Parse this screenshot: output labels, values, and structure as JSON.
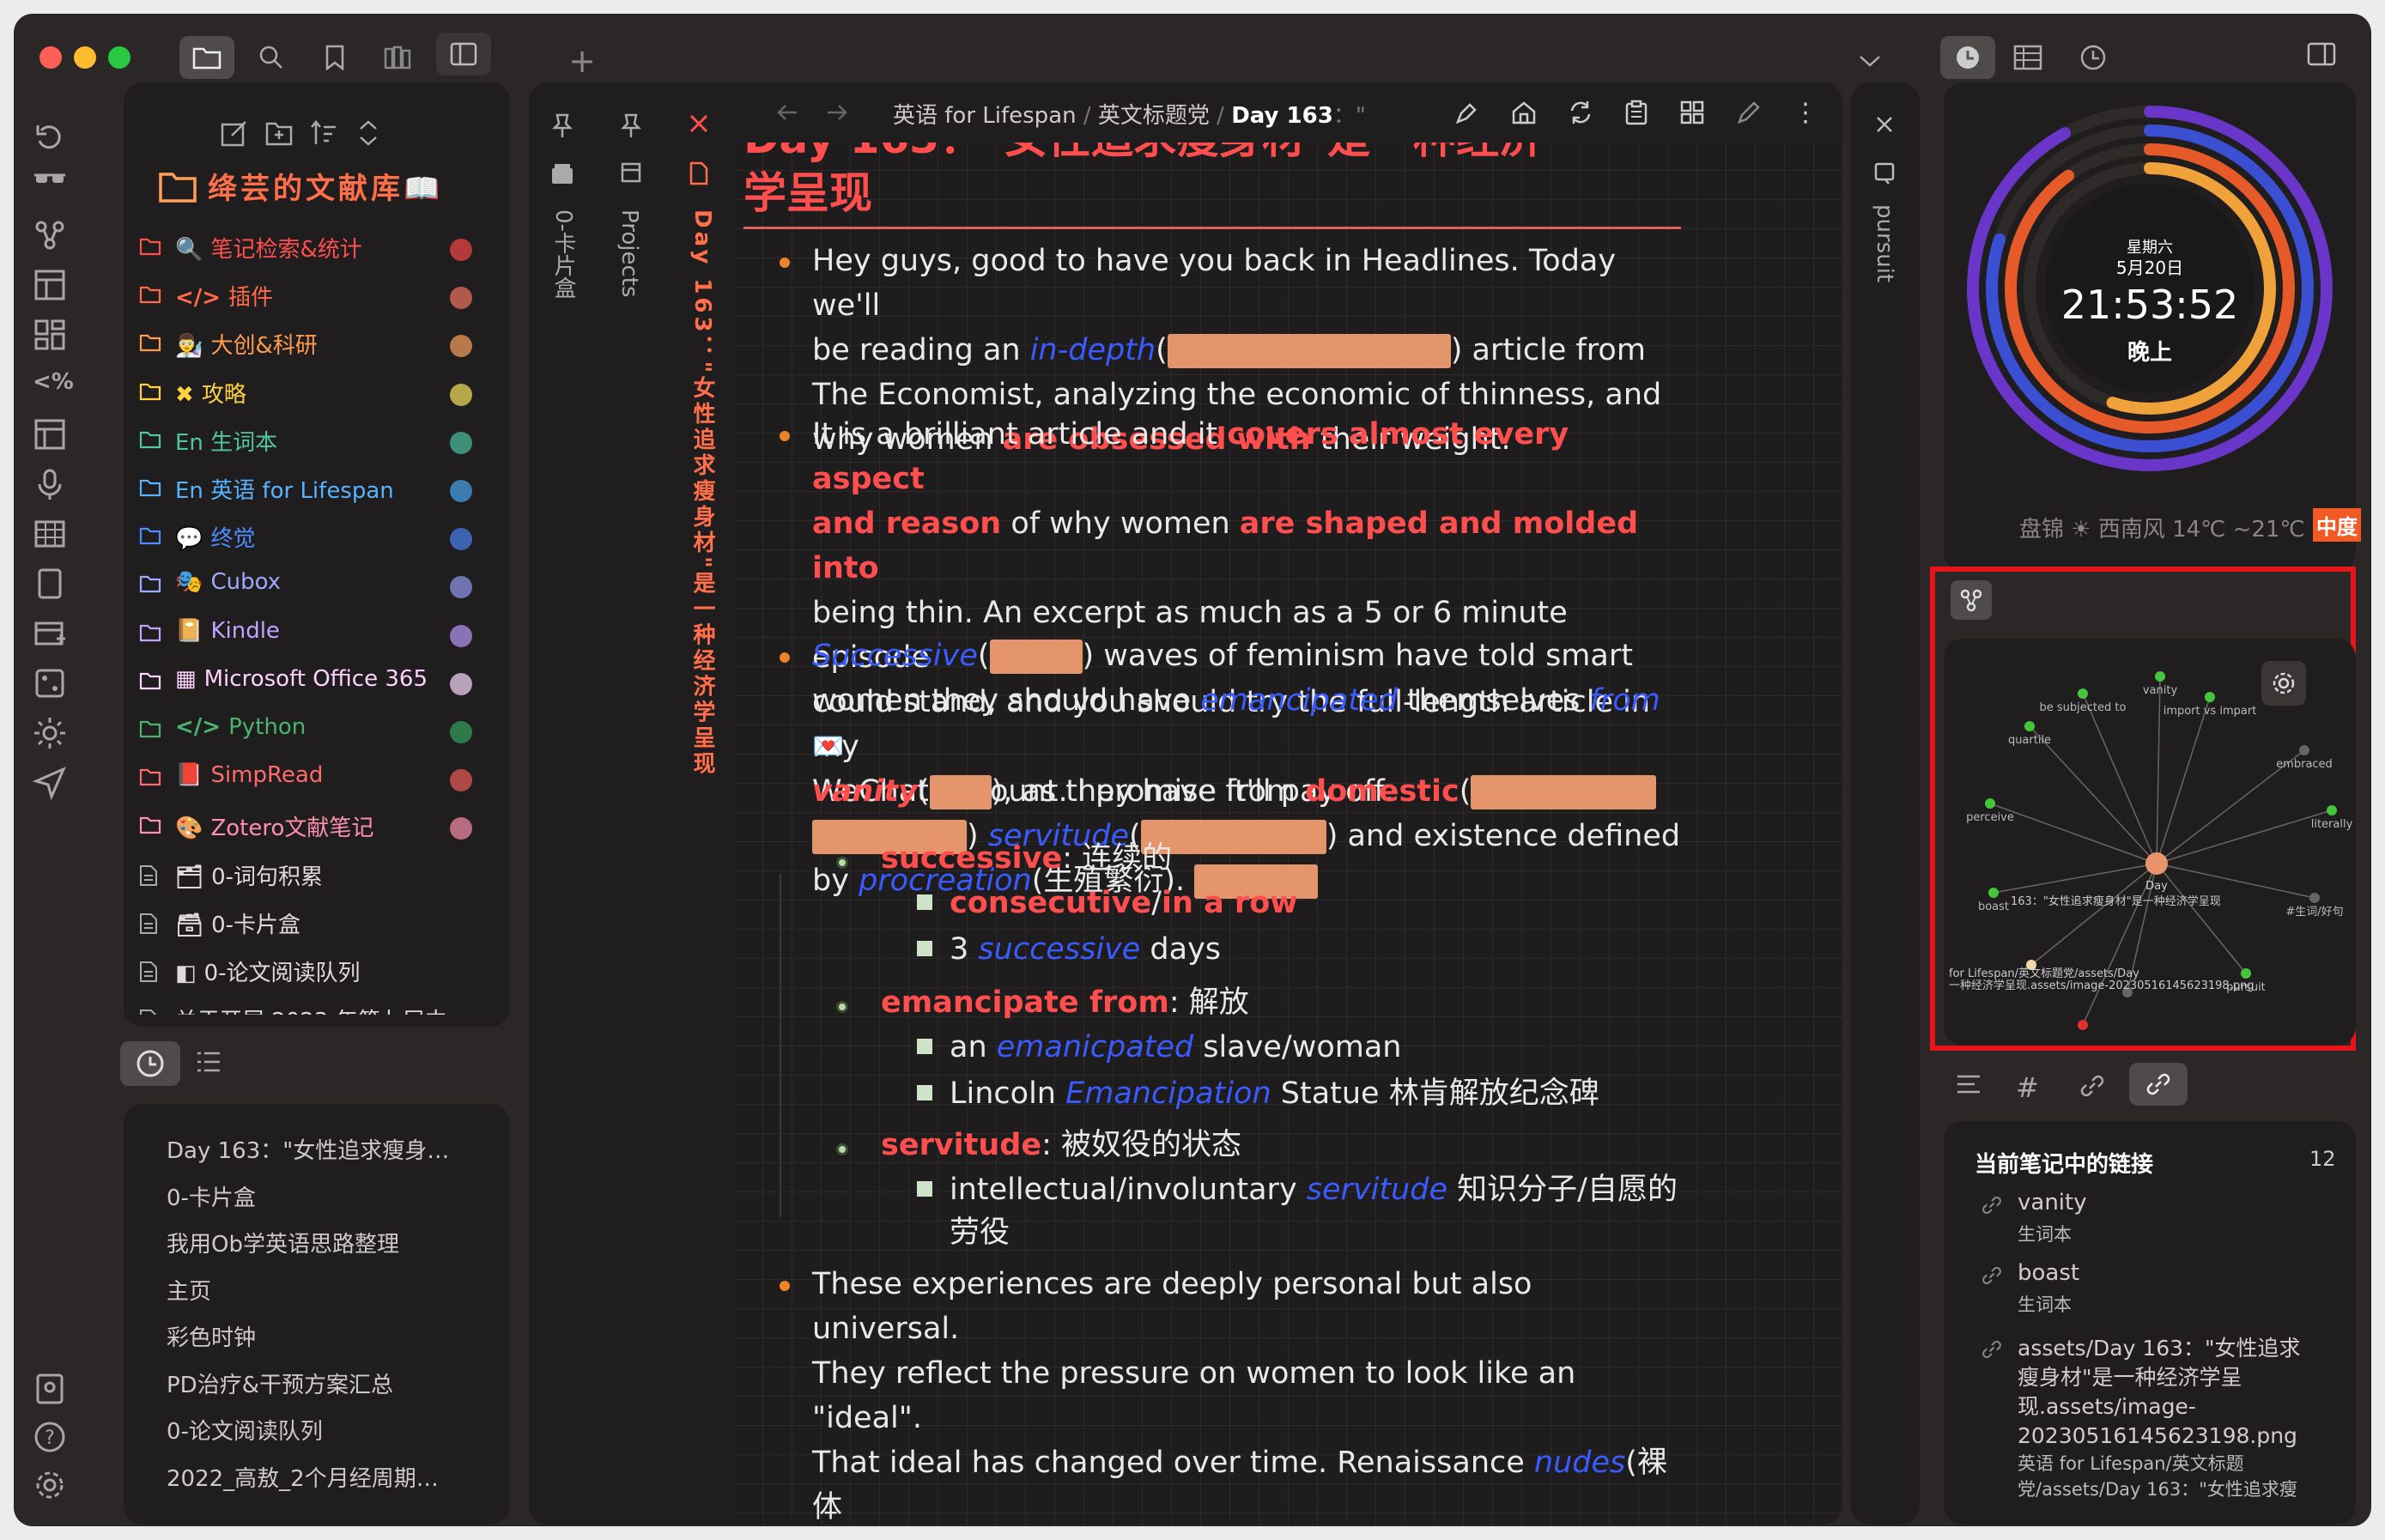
{
  "window": {
    "tb_right_tab": "pursuit"
  },
  "sidebar": {
    "vault_title": "绛芸的文献库📖",
    "items": [
      {
        "label": "笔记检索&统计",
        "icon": "🔍",
        "color": "#ff4f4f",
        "dot": "#b23a3a"
      },
      {
        "label": "插件",
        "icon": "</>",
        "color": "#ff6a4a",
        "dot": "#b25a4a"
      },
      {
        "label": "大创&科研",
        "icon": "👨‍🔬",
        "color": "#ff9c50",
        "dot": "#b7784a"
      },
      {
        "label": "攻略",
        "icon": "✖",
        "color": "#ffd23f",
        "dot": "#b8a64a"
      },
      {
        "label": "En 生词本",
        "icon": "",
        "color": "#4fc6a1",
        "dot": "#3e8f7a"
      },
      {
        "label": "En 英语 for Lifespan",
        "icon": "",
        "color": "#56b3ff",
        "dot": "#3d7cb0"
      },
      {
        "label": "终觉",
        "icon": "💬",
        "color": "#4d8dff",
        "dot": "#3b63b0"
      },
      {
        "label": "Cubox",
        "icon": "🎭",
        "color": "#9fa8ff",
        "dot": "#6e74b0"
      },
      {
        "label": "Kindle",
        "icon": "📔",
        "color": "#c0a5ff",
        "dot": "#8a73b5"
      },
      {
        "label": "Microsoft Office 365",
        "icon": "▦",
        "color": "#ffd1ff",
        "dot": "#b9a2b9"
      },
      {
        "label": "Python",
        "icon": "</>",
        "color": "#49b46d",
        "dot": "#2f7a4a"
      },
      {
        "label": "SimpRead",
        "icon": "📕",
        "color": "#ff6a6a",
        "dot": "#b04848"
      },
      {
        "label": "Zotero文献笔记",
        "icon": "🎨",
        "color": "#ff8fb0",
        "dot": "#b86a7e"
      },
      {
        "label": "0-词句积累",
        "icon": "🗂",
        "color": "#e0dada",
        "dot": ""
      },
      {
        "label": "0-卡片盒",
        "icon": "🗃",
        "color": "#e0dada",
        "dot": ""
      },
      {
        "label": "0-论文阅读队列",
        "icon": "◧",
        "color": "#e0dada",
        "dot": ""
      },
      {
        "label": "关于开展 2023 年第九届中…",
        "icon": "",
        "color": "#e0dada",
        "dot": ""
      }
    ],
    "recent": [
      "Day 163：\"女性追求瘦身…",
      "0-卡片盒",
      "我用Ob学英语思路整理",
      "主页",
      "彩色时钟",
      "PD治疗&干预方案汇总",
      "0-论文阅读队列",
      "2022_高敖_2个月经周期…"
    ]
  },
  "tabs": {
    "vertical": [
      "0-卡片盒",
      "Projects",
      "Day 163：\"女性追求瘦身材\"是一种经济学呈现"
    ]
  },
  "editor": {
    "breadcrumb": {
      "a": "英语 for Lifespan",
      "b": "英文标题党",
      "c": "Day 163"
    },
    "title_line1": "Day 163：\"女性追求瘦身材\"是一种经济",
    "title_line2": "学呈现",
    "para1": {
      "t1": "Hey guys, good to have you back in Headlines. Today we'll",
      "t2a": "be reading an ",
      "t2b": "in-depth",
      "t2c": "(",
      "t2d": ") article from",
      "t3": "The Economist, analyzing the economic of thinness, and",
      "t4a": "why women ",
      "t4b": "are obsessed with",
      "t4c": " their weight."
    },
    "para2": {
      "t1a": "It is a brilliant article and it ",
      "t1b": "covers almost every aspect",
      "t2a": "and reason",
      "t2b": " of why women ",
      "t2c": "are shaped and molded into",
      "t3": "being thin. An excerpt as much as a 5 or 6 minute episode",
      "t4": "could stand, and you should try the full-length article in my",
      "t5": "WeChat account. I promise it'll pay off."
    },
    "para3": {
      "t1a": "Successive",
      "t1b": "(",
      "t1c": ") waves of feminism have told smart",
      "t2a": "women they should have ",
      "t2b": "emancipated",
      "t2c": " themselves ",
      "t2d": "from",
      "t3a": "vanity",
      "t3b": "(",
      "t3c": "), as they have from ",
      "t3d": "domestic",
      "t3e": "(",
      "t4a": ") ",
      "t4b": "servitude",
      "t4c": "(",
      "t4d": ") and existence defined",
      "t5a": "by ",
      "t5b": "procreation",
      "t5c": "(生殖繁衍)."
    },
    "sub1": {
      "head": "successive",
      "gloss": ": 连续的",
      "i1a": "consecutive",
      "i1b": "/",
      "i1c": "in a row",
      "i2a": "3 ",
      "i2b": "successive",
      "i2c": " days"
    },
    "sub2": {
      "head": "emancipate from",
      "gloss": ": 解放",
      "i1a": "an ",
      "i1b": "emanicpated",
      "i1c": " slave/woman",
      "i2a": "Lincoln ",
      "i2b": "Emancipation",
      "i2c": " Statue 林肯解放纪念碑"
    },
    "sub3": {
      "head": "servitude",
      "gloss": ": 被奴役的状态",
      "i1a": "intellectual/involuntary ",
      "i1b": "servitude",
      "i1c": " 知识分子/自愿的",
      "i1d": "劳役"
    },
    "para4": {
      "t1": "These experiences are deeply personal but also universal.",
      "t2": "They reflect the pressure on women to look like an \"ideal\".",
      "t3a": "That ideal has changed over time. Renaissance ",
      "t3b": "nudes",
      "t3c": "(裸体"
    }
  },
  "clock": {
    "weekday": "星期六",
    "date": "5月20日",
    "time": "21:53:52",
    "period": "晚上",
    "weather": "盘锦 ☀ 西南风 14℃ ~21℃",
    "aqi": "中度"
  },
  "graph": {
    "nodes": {
      "vanity": "vanity",
      "subjected": "be subjected to",
      "import": "import vs impart",
      "quartile": "quartile",
      "embraced": "embraced",
      "perceive": "perceive",
      "literally": "literally",
      "day": "Day",
      "day163": "163：\"女性追求瘦身材\"是一种经济学呈现",
      "boast": "boast",
      "tag": "#生词/好句",
      "path1": "for Lifespan/英文标题党/assets/Day",
      "path2": "一种经济学呈现.assets/image-20230516145623198.png",
      "pursuit": "pursuit"
    }
  },
  "links": {
    "header": "当前笔记中的链接",
    "count": "12",
    "items": [
      {
        "name": "vanity",
        "sub": "生词本"
      },
      {
        "name": "boast",
        "sub": "生词本"
      }
    ],
    "asset": {
      "l1": "assets/Day 163：\"女性追求",
      "l2": "瘦身材\"是一种经济学呈",
      "l3": "现.assets/image-",
      "l4": "20230516145623198.png",
      "l5": "英语 for Lifespan/英文标题",
      "l6": "党/assets/Day 163：\"女性追求瘦"
    }
  },
  "colors": {
    "highlight_box": "#e8141a",
    "accent_orange": "#e9842a",
    "red_text": "#ff4e4e",
    "blue_text": "#3a5bff"
  }
}
